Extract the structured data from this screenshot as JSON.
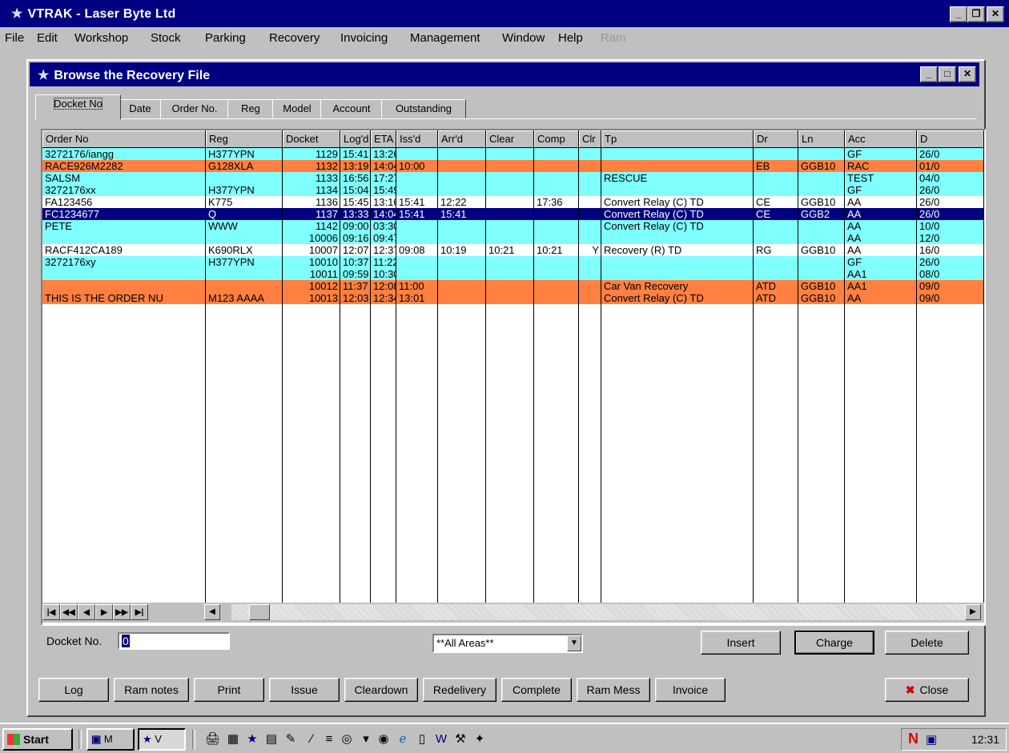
{
  "app": {
    "title": "VTRAK - Laser Byte Ltd",
    "title_icon": "star-icon"
  },
  "menu": [
    "File",
    "Edit",
    "Workshop",
    "Stock",
    "Parking",
    "Recovery",
    "Invoicing",
    "Management",
    "Window",
    "Help",
    "Ram"
  ],
  "window": {
    "title": "Browse the Recovery File",
    "title_icon": "star-icon"
  },
  "tabs": [
    "Docket No",
    "Date",
    "Order No.",
    "Reg",
    "Model",
    "Account",
    "Outstanding"
  ],
  "active_tab": "Docket No",
  "grid": {
    "columns": [
      "Order No",
      "Reg",
      "Docket",
      "Log'd",
      "ETA",
      "Iss'd",
      "Arr'd",
      "Clear",
      "Comp",
      "Clr",
      "Tp",
      "Dr",
      "Ln",
      "Acc",
      "D"
    ],
    "rows": [
      {
        "style": "cyan",
        "cells": [
          "3272176/iangg",
          "H377YPN",
          "1129",
          "15:41",
          "13:26",
          "",
          "",
          "",
          "",
          "",
          "",
          "",
          "",
          "GF",
          "26/0"
        ]
      },
      {
        "style": "orange",
        "cells": [
          "RACE926M2282",
          "G128XLA",
          "1132",
          "13:19",
          "14:04",
          "10:00",
          "",
          "",
          "",
          "",
          "",
          "EB",
          "GGB10",
          "RAC",
          "01/0"
        ]
      },
      {
        "style": "cyan",
        "cells": [
          "SALSM",
          "",
          "1133",
          "16:56",
          "17:27",
          "",
          "",
          "",
          "",
          "",
          "RESCUE",
          "",
          "",
          "TEST",
          "04/0"
        ]
      },
      {
        "style": "cyan",
        "cells": [
          "3272176xx",
          "H377YPN",
          "1134",
          "15:04",
          "15:49",
          "",
          "",
          "",
          "",
          "",
          "",
          "",
          "",
          "GF",
          "26/0"
        ]
      },
      {
        "style": "white",
        "cells": [
          "FA123456",
          "K775",
          "1136",
          "15:45",
          "13:16",
          "15:41",
          "12:22",
          "",
          "17:36",
          "",
          "Convert Relay (C) TD",
          "CE",
          "GGB10",
          "AA",
          "26/0"
        ]
      },
      {
        "style": "sel",
        "cells": [
          "FC1234677",
          "Q",
          "1137",
          "13:33",
          "14:04",
          "15:41",
          "15:41",
          "",
          "",
          "",
          "Convert Relay (C) TD",
          "CE",
          "GGB2",
          "AA",
          "26/0"
        ]
      },
      {
        "style": "cyan",
        "cells": [
          "PETE",
          "WWW",
          "1142",
          "09:00",
          "03:30",
          "",
          "",
          "",
          "",
          "",
          "Convert Relay (C) TD",
          "",
          "",
          "AA",
          "10/0"
        ]
      },
      {
        "style": "cyan",
        "cells": [
          "",
          "",
          "10006",
          "09:16",
          "09:47",
          "",
          "",
          "",
          "",
          "",
          "",
          "",
          "",
          "AA",
          "12/0"
        ]
      },
      {
        "style": "white",
        "cells": [
          "RACF412CA189",
          "K690RLX",
          "10007",
          "12:07",
          "12:37",
          "09:08",
          "10:19",
          "10:21",
          "10:21",
          "Y",
          "Recovery (R) TD",
          "RG",
          "GGB10",
          "AA",
          "16/0"
        ]
      },
      {
        "style": "cyan",
        "cells": [
          "3272176xy",
          "H377YPN",
          "10010",
          "10:37",
          "11:22",
          "",
          "",
          "",
          "",
          "",
          "",
          "",
          "",
          "GF",
          "26/0"
        ]
      },
      {
        "style": "cyan",
        "cells": [
          "",
          "",
          "10011",
          "09:59",
          "10:30",
          "",
          "",
          "",
          "",
          "",
          "",
          "",
          "",
          "AA1",
          "08/0"
        ]
      },
      {
        "style": "orange",
        "cells": [
          "",
          "",
          "10012",
          "11:37",
          "12:08",
          "11:00",
          "",
          "",
          "",
          "",
          "Car  Van Recovery",
          "ATD",
          "GGB10",
          "AA1",
          "09/0"
        ]
      },
      {
        "style": "orange",
        "cells": [
          "THIS IS THE ORDER NU",
          "M123 AAAA",
          "10013",
          "12:03",
          "12:34",
          "13:01",
          "",
          "",
          "",
          "",
          "Convert Relay (C) TD",
          "ATD",
          "GGB10",
          "AA",
          "09/0"
        ]
      }
    ]
  },
  "nav_buttons": [
    "first-page",
    "prev-page",
    "prev-record",
    "next-record",
    "next-page",
    "last-page"
  ],
  "docket_label": "Docket No.",
  "docket_value": "0",
  "area_select": "**All Areas**",
  "buttons_right": [
    "Insert",
    "Charge",
    "Delete"
  ],
  "buttons_bottom": [
    "Log",
    "Ram notes",
    "Print",
    "Issue",
    "Cleardown",
    "Redelivery",
    "Complete",
    "Ram Mess",
    "Invoice"
  ],
  "close_label": "Close",
  "taskbar": {
    "start": "Start",
    "tasks": [
      "M",
      "V"
    ],
    "clock": "12:31"
  },
  "colors": {
    "title_bg": "#000080",
    "row_cyan": "#80ffff",
    "row_orange": "#ff8040",
    "row_selected": "#000080",
    "face": "#c0c0c0"
  }
}
